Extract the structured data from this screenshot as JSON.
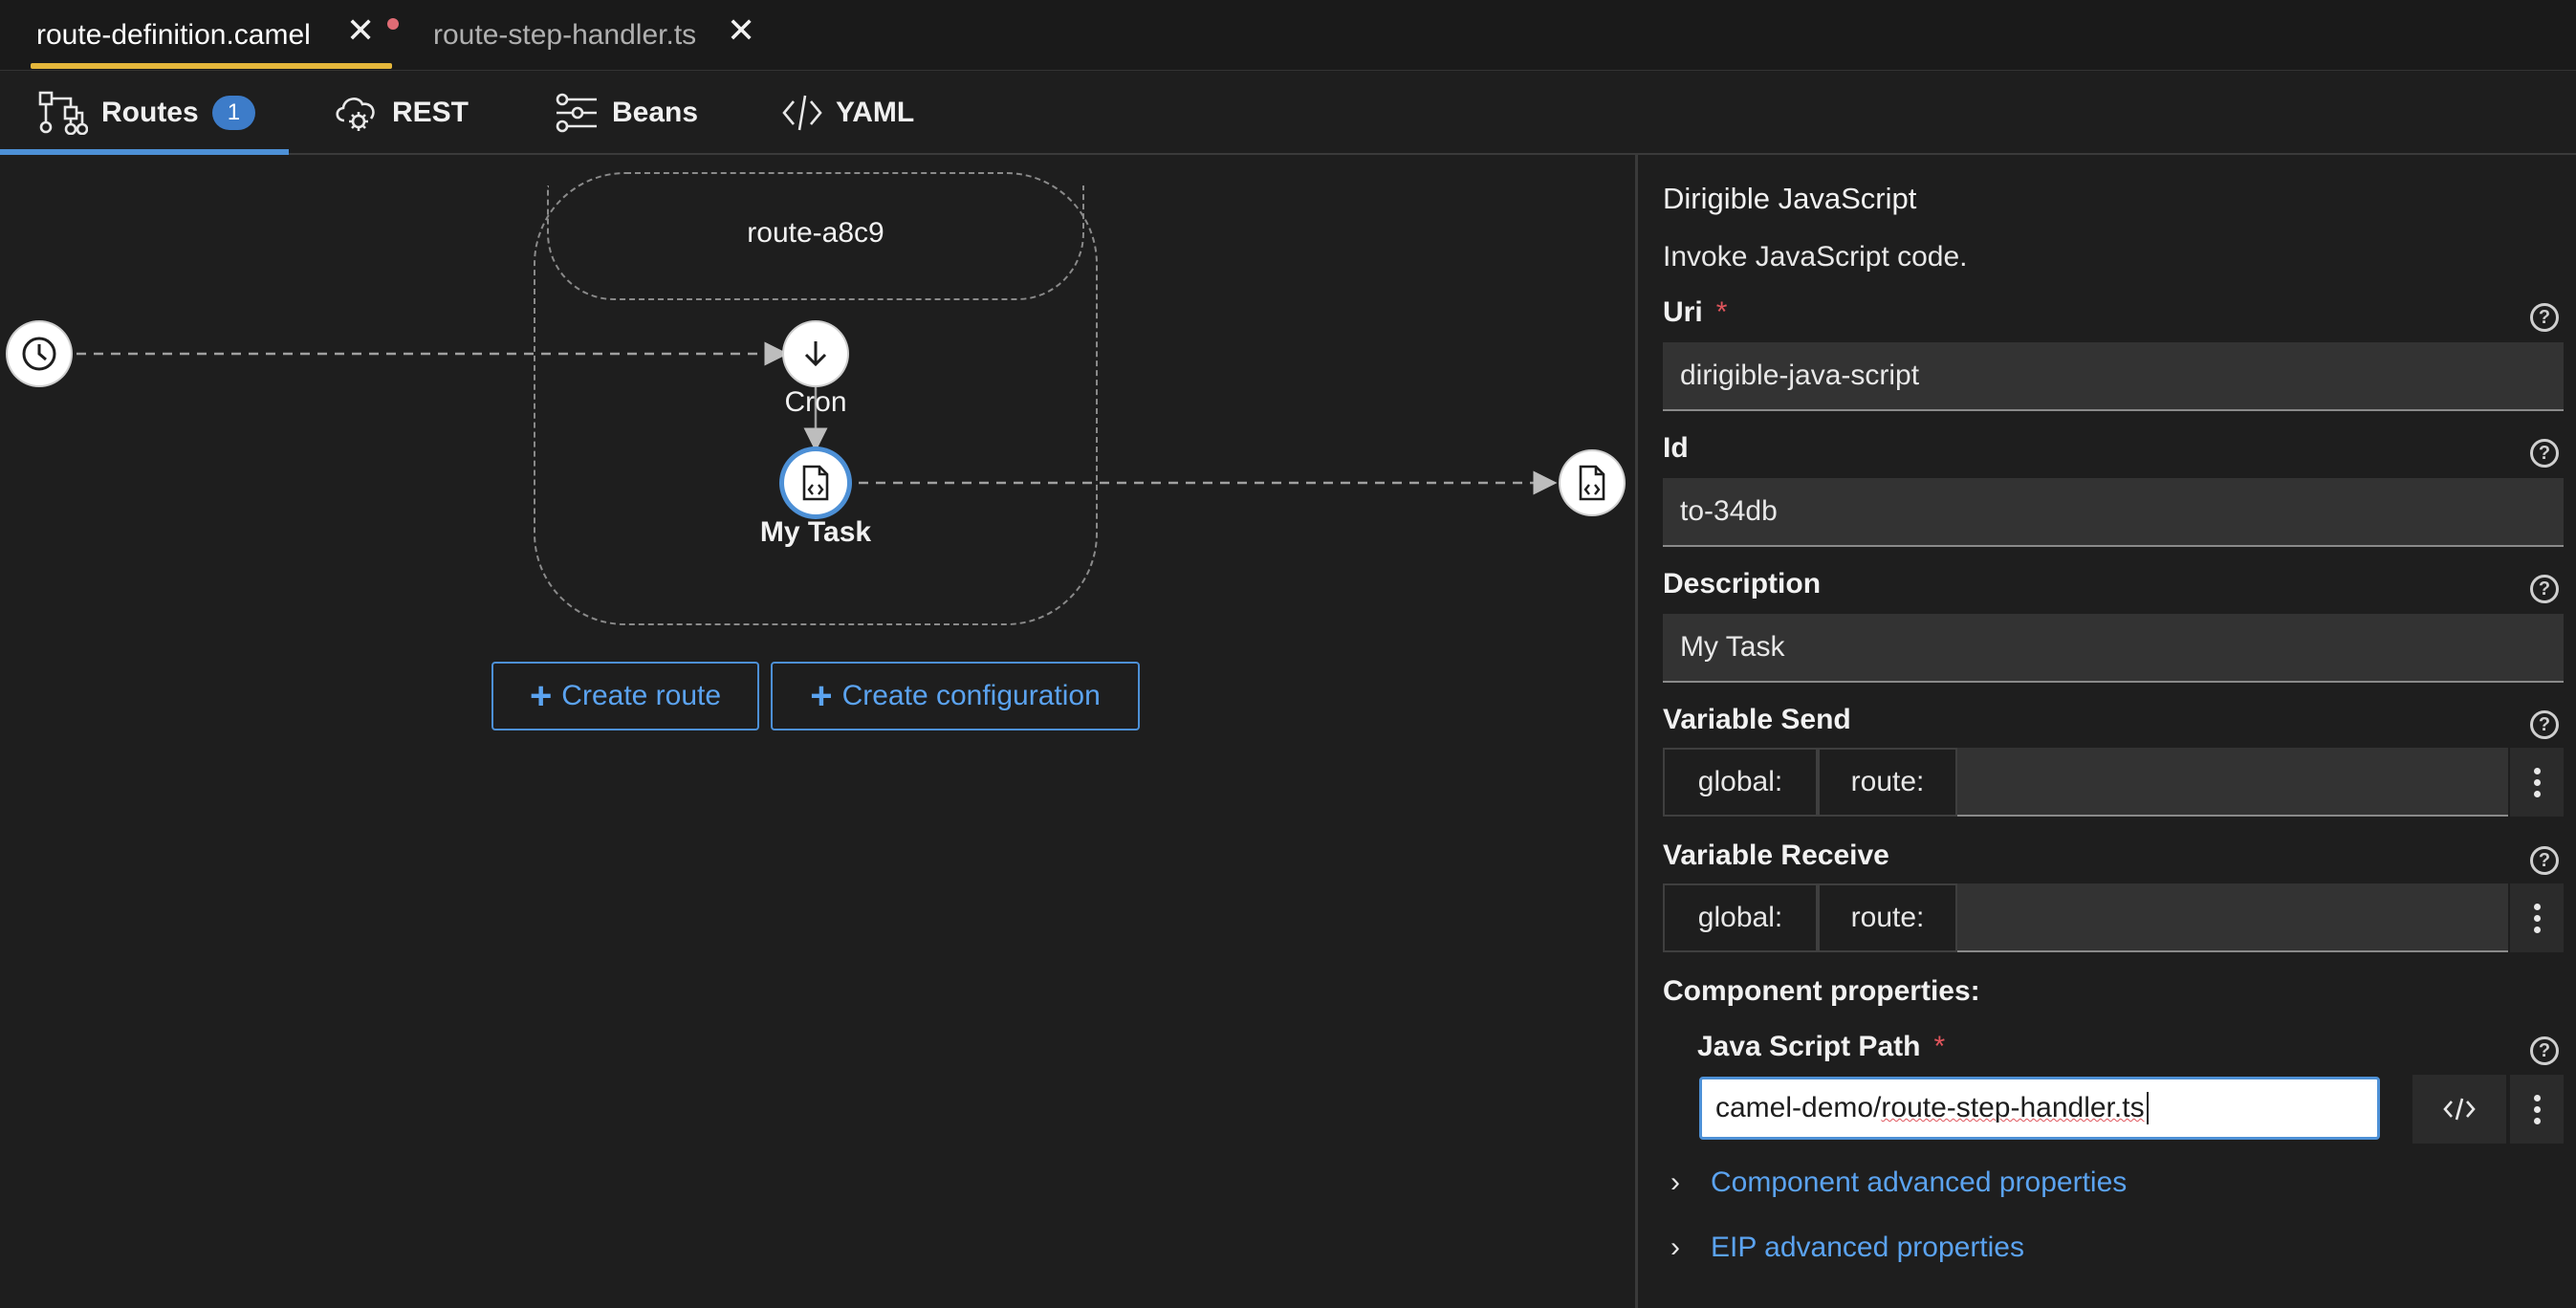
{
  "editor_tabs": [
    {
      "label": "route-definition.camel",
      "active": true,
      "dirty": true
    },
    {
      "label": "route-step-handler.ts",
      "active": false,
      "dirty": false
    }
  ],
  "view_tabs": [
    {
      "label": "Routes",
      "icon": "routes-icon",
      "badge": "1",
      "active": true
    },
    {
      "label": "REST",
      "icon": "cloud-gear-icon"
    },
    {
      "label": "Beans",
      "icon": "sliders-icon"
    },
    {
      "label": "YAML",
      "icon": "code-icon"
    }
  ],
  "canvas": {
    "route_name": "route-a8c9",
    "nodes": {
      "timer": {
        "icon": "clock-icon"
      },
      "cron": {
        "label": "Cron",
        "icon": "arrow-down-icon"
      },
      "task": {
        "label": "My Task",
        "icon": "file-code-icon",
        "selected": true
      },
      "target": {
        "icon": "file-code-icon"
      }
    },
    "buttons": {
      "create_route": "Create route",
      "create_configuration": "Create configuration"
    }
  },
  "panel": {
    "title": "Dirigible JavaScript",
    "description": "Invoke JavaScript code.",
    "required_mark": "*",
    "fields": {
      "uri": {
        "label": "Uri",
        "value": "dirigible-java-script"
      },
      "id": {
        "label": "Id",
        "value": "to-34db"
      },
      "description": {
        "label": "Description",
        "value": "My Task"
      }
    },
    "variable_send": {
      "label": "Variable Send",
      "global": "global:",
      "route": "route:",
      "value": ""
    },
    "variable_receive": {
      "label": "Variable Receive",
      "global": "global:",
      "route": "route:",
      "value": ""
    },
    "component_properties": {
      "heading": "Component properties:",
      "java_script_path": {
        "label": "Java Script Path",
        "value_plain": "camel-demo/",
        "value_marked": "route-step-handler.ts"
      }
    },
    "expanders": {
      "component_advanced": "Component advanced properties",
      "eip_advanced": "EIP advanced properties"
    }
  },
  "colors": {
    "accent": "#4d90d6",
    "tab_underline": "#e5b73b",
    "link": "#5ba3f0",
    "required": "#e0555c"
  }
}
